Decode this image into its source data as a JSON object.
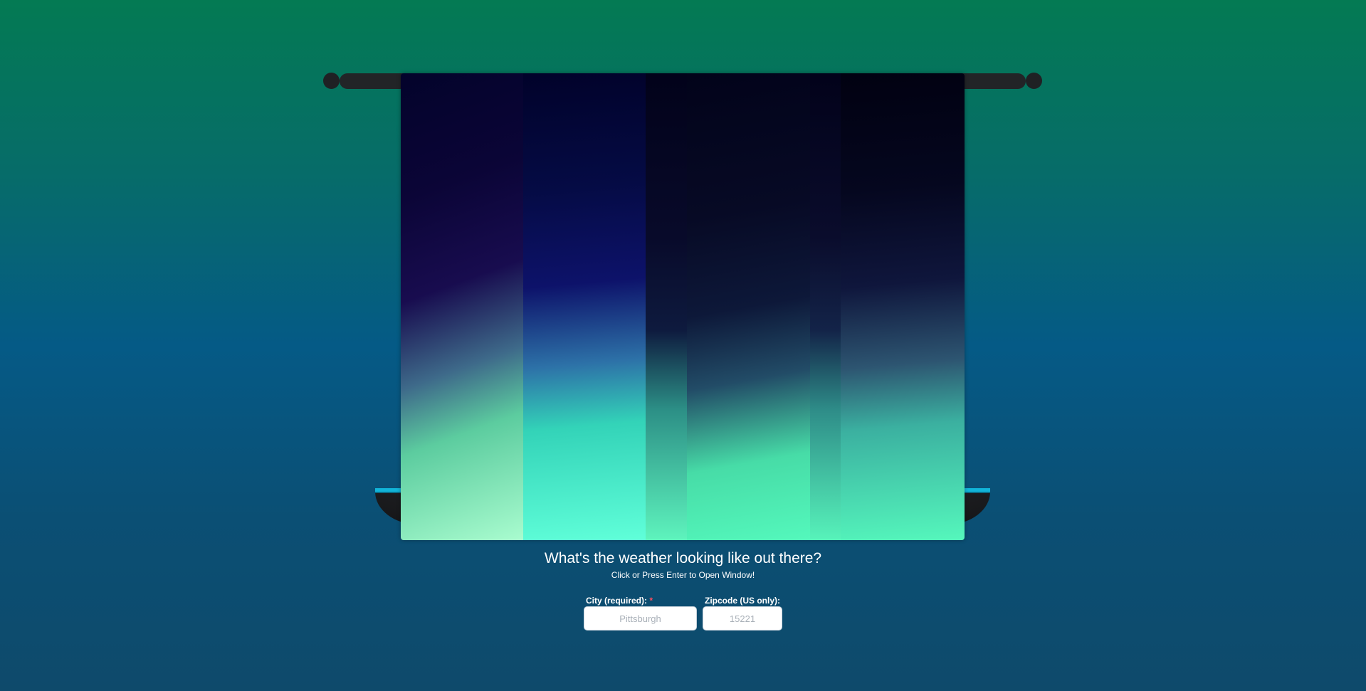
{
  "prompt": {
    "headline": "What's the weather looking like out there?",
    "instruction": "Click or Press Enter to Open Window!"
  },
  "form": {
    "city": {
      "label": "City (required):",
      "required_marker": "*",
      "placeholder": "Pittsburgh",
      "value": ""
    },
    "zip": {
      "label": "Zipcode (US only):",
      "placeholder": "15221",
      "value": ""
    }
  },
  "colors": {
    "background_top": "#047a53",
    "background_bottom": "#0e4a6b",
    "sill_accent": "#11b4d9",
    "required_marker": "#ff4d5e",
    "curtain_glow": "#5ef4bd"
  }
}
